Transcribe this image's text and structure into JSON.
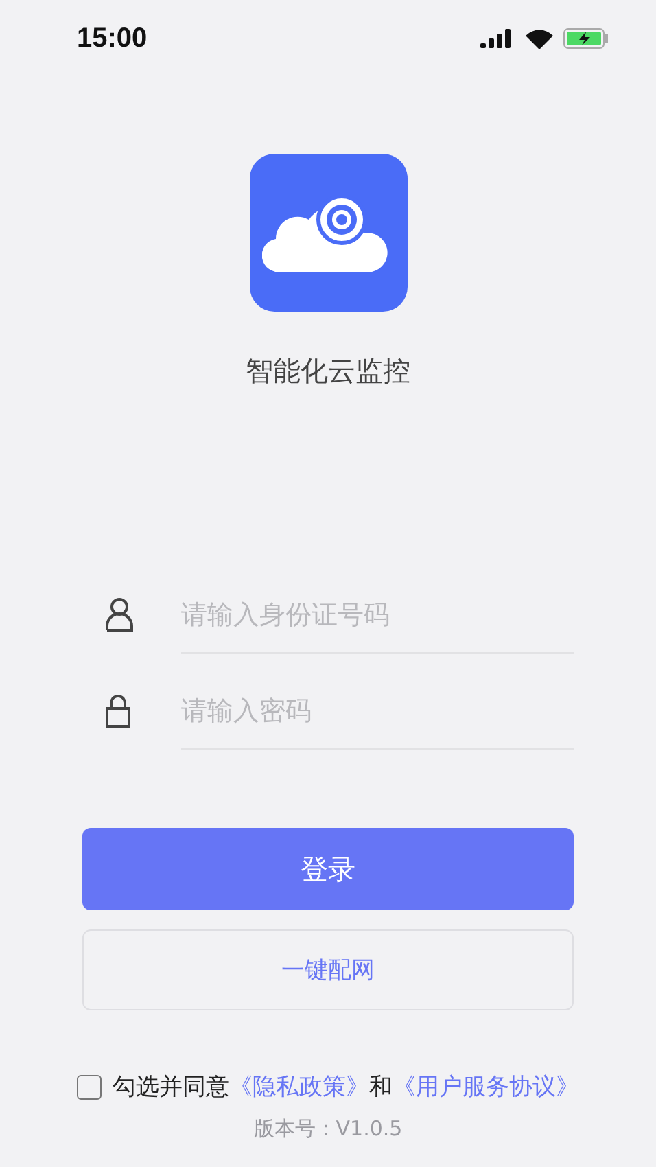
{
  "status_bar": {
    "time": "15:00"
  },
  "app": {
    "name": "智能化云监控"
  },
  "fields": [
    {
      "kind": "user",
      "placeholder": "请输入身份证号码"
    },
    {
      "kind": "lock",
      "placeholder": "请输入密码"
    }
  ],
  "buttons": [
    {
      "kind": "primary",
      "label": "登录"
    },
    {
      "kind": "outline",
      "label": "一键配网"
    }
  ],
  "agreement": {
    "checked": false,
    "text": "勾选并同意",
    "links": [
      "《隐私政策》",
      "《用户服务协议》"
    ],
    "joiner": "和"
  },
  "version": "版本号：V1.0.5"
}
